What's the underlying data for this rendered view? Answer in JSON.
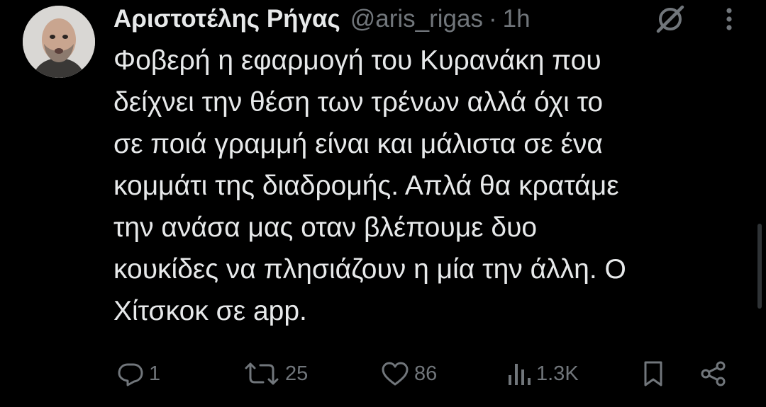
{
  "tweet": {
    "author_name": "Αριστοτέλης Ρήγας",
    "handle": "@aris_rigas",
    "separator": "·",
    "time": "1h",
    "text": "Φοβερή η εφαρμογή του Κυρανάκη που\nδείχνει την θέση των τρένων αλλά όχι το\nσε ποιά γραμμή είναι και μάλιστα σε ένα\nκομμάτι της διαδρομής. Απλά θα κρατάμε\nτην ανάσα μας οταν βλέπουμε δυο\nκουκίδες να πλησιάζουν η μία την άλλη. Ο\nΧίτσκοκ σε app."
  },
  "actions": {
    "replies": "1",
    "reposts": "25",
    "likes": "86",
    "views": "1.3K"
  },
  "icons": {
    "header": [
      "grok-icon",
      "more-options-icon"
    ],
    "actions": [
      "reply-icon",
      "repost-icon",
      "like-icon",
      "views-icon",
      "bookmark-icon",
      "share-icon"
    ]
  },
  "colors": {
    "background": "#000000",
    "text_primary": "#e7e9ea",
    "text_secondary": "#71767b"
  }
}
